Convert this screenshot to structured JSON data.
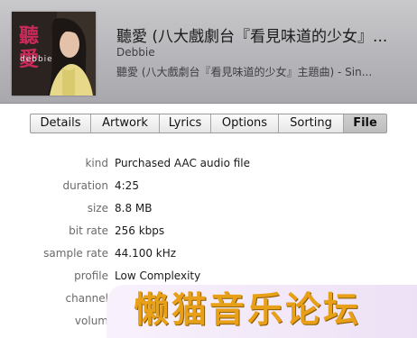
{
  "header": {
    "artwork": {
      "title_chars": "聽愛",
      "artist_caption": "debbie",
      "accent_color": "#c82a5a"
    },
    "title": "聽愛 (八大戲劇台『看見味道的少女』...",
    "artist": "Debbie",
    "album": "聽愛 (八大戲劇台『看見味道的少女』主題曲) - Sin..."
  },
  "tabs": [
    {
      "label": "Details",
      "active": false
    },
    {
      "label": "Artwork",
      "active": false
    },
    {
      "label": "Lyrics",
      "active": false
    },
    {
      "label": "Options",
      "active": false
    },
    {
      "label": "Sorting",
      "active": false
    },
    {
      "label": "File",
      "active": true
    }
  ],
  "file_info": [
    {
      "label": "kind",
      "value": "Purchased AAC audio file"
    },
    {
      "label": "duration",
      "value": "4:25"
    },
    {
      "label": "size",
      "value": "8.8 MB"
    },
    {
      "label": "bit rate",
      "value": "256 kbps"
    },
    {
      "label": "sample rate",
      "value": "44.100 kHz"
    },
    {
      "label": "profile",
      "value": "Low Complexity"
    },
    {
      "label": "channel",
      "value": ""
    },
    {
      "label": "volum",
      "value": ""
    }
  ],
  "watermark": {
    "text": "懒猫音乐论坛",
    "color": "#e8a018"
  }
}
